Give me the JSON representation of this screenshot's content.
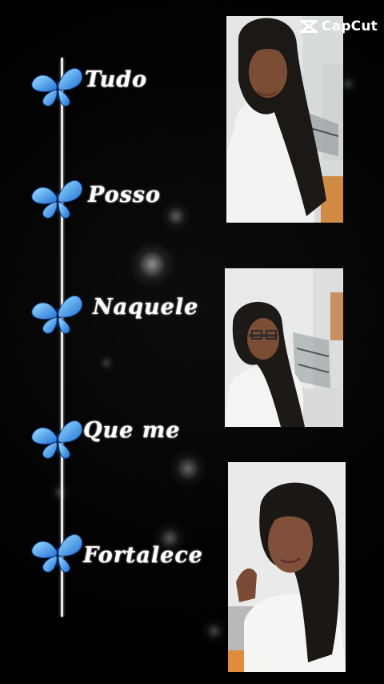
{
  "watermark": {
    "text": "CapCut",
    "icon": "capcut-logo-icon"
  },
  "steps": [
    {
      "label": "Tudo",
      "icon": "blue-butterfly-icon"
    },
    {
      "label": "Posso",
      "icon": "blue-butterfly-icon"
    },
    {
      "label": "Naquele",
      "icon": "blue-butterfly-icon"
    },
    {
      "label": "Que me",
      "icon": "blue-butterfly-icon"
    },
    {
      "label": "Fortalece",
      "icon": "blue-butterfly-icon"
    }
  ],
  "colors": {
    "background": "#000000",
    "butterfly": "#3aa0f0",
    "timeline": "#e8e8e8",
    "text": "#ffffff"
  }
}
